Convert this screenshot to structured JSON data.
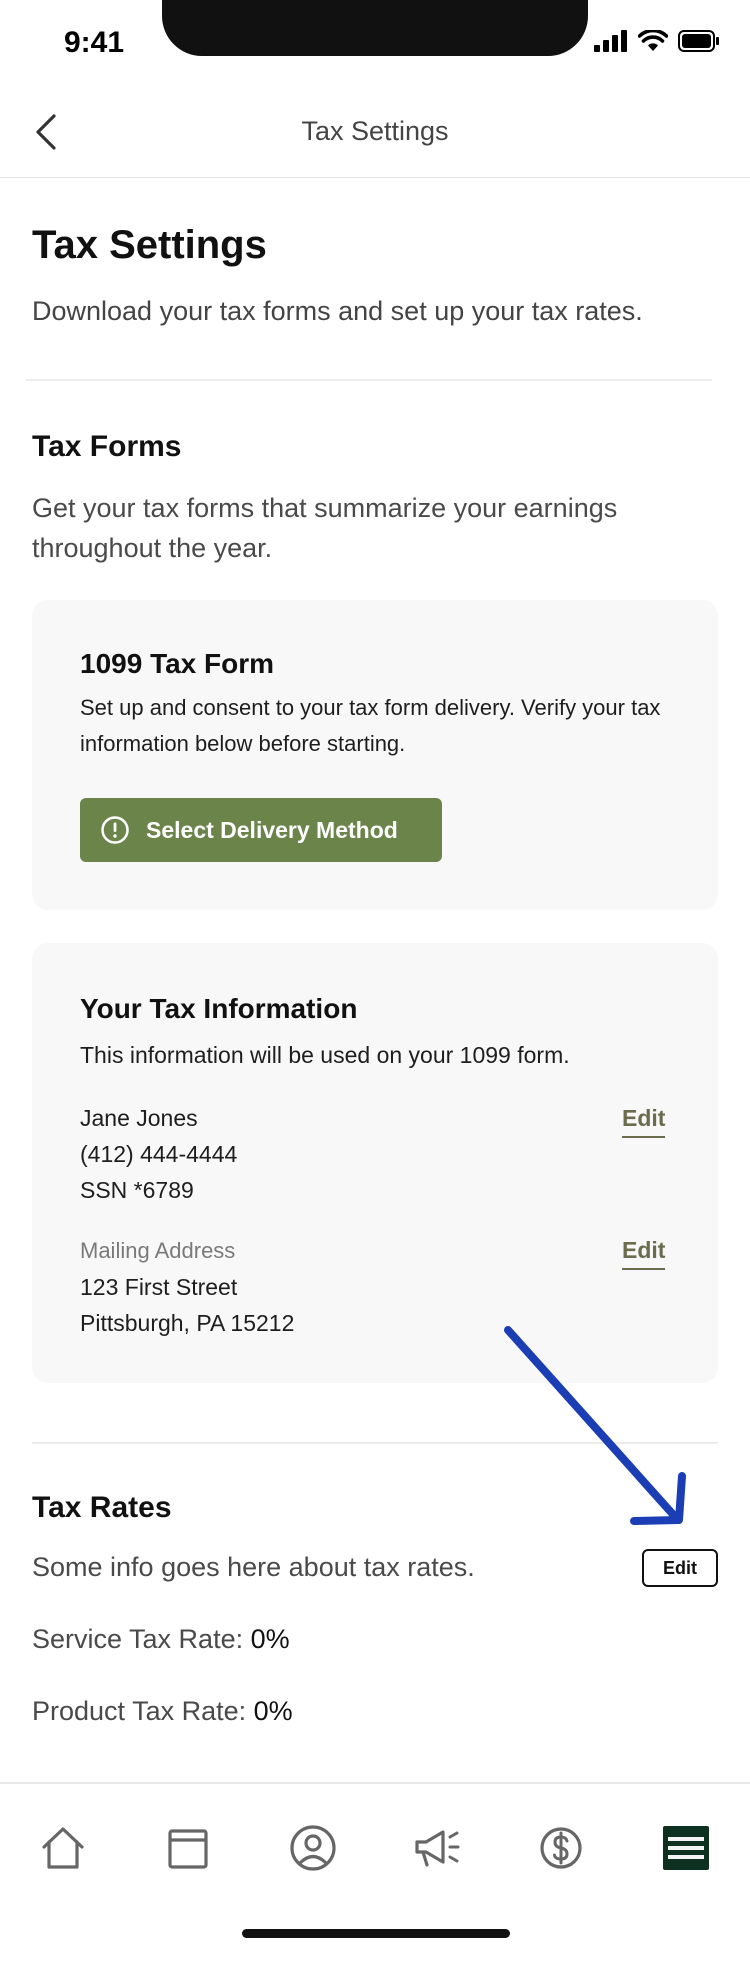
{
  "status_bar": {
    "time": "9:41"
  },
  "header": {
    "title": "Tax Settings"
  },
  "page": {
    "title": "Tax Settings",
    "subtitle": "Download your tax forms and set up your tax rates."
  },
  "tax_forms": {
    "title": "Tax Forms",
    "description": "Get your tax forms that summarize your earnings throughout the year.",
    "form_card": {
      "title": "1099 Tax Form",
      "description": "Set up and consent to your tax form delivery. Verify your tax information below before starting.",
      "button_label": "Select Delivery Method"
    },
    "info_card": {
      "title": "Your Tax Information",
      "description": "This information will be used on your 1099 form.",
      "name": "Jane Jones",
      "phone": "(412) 444-4444",
      "ssn": "SSN *6789",
      "mailing_label": "Mailing Address",
      "street": "123 First Street",
      "city": "Pittsburgh, PA 15212",
      "edit_label": "Edit"
    }
  },
  "tax_rates": {
    "title": "Tax Rates",
    "description": "Some info goes here about tax rates.",
    "edit_label": "Edit",
    "service_label": "Service Tax Rate: ",
    "service_value": "0%",
    "product_label": "Product Tax Rate: ",
    "product_value": "0%"
  },
  "tabs": [
    {
      "icon": "home-icon"
    },
    {
      "icon": "calendar-icon"
    },
    {
      "icon": "user-icon"
    },
    {
      "icon": "megaphone-icon"
    },
    {
      "icon": "dollar-icon"
    },
    {
      "icon": "menu-icon"
    }
  ],
  "colors": {
    "accent": "#6b844a",
    "edit_link": "#6b6b4e",
    "annotation": "#1b3eb5",
    "active_tab": "#0d3020"
  }
}
